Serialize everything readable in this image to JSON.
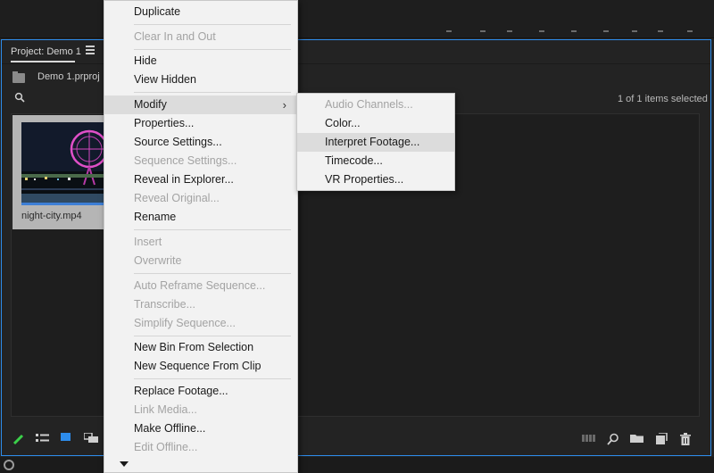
{
  "project_panel": {
    "tab_label": "Project: Demo 1",
    "project_file": "Demo 1.prproj",
    "selection_count": "1 of 1 items selected",
    "clip_name": "night-city.mp4"
  },
  "context_menu": {
    "items": [
      {
        "label": "Duplicate",
        "enabled": true
      },
      {
        "label": "Clear In and Out",
        "enabled": false
      },
      {
        "label": "Hide",
        "enabled": true
      },
      {
        "label": "View Hidden",
        "enabled": true
      },
      {
        "label": "Modify",
        "enabled": true,
        "has_submenu": true,
        "highlighted": true
      },
      {
        "label": "Properties...",
        "enabled": true
      },
      {
        "label": "Source Settings...",
        "enabled": true
      },
      {
        "label": "Sequence Settings...",
        "enabled": false
      },
      {
        "label": "Reveal in Explorer...",
        "enabled": true
      },
      {
        "label": "Reveal Original...",
        "enabled": false
      },
      {
        "label": "Rename",
        "enabled": true
      },
      {
        "label": "Insert",
        "enabled": false
      },
      {
        "label": "Overwrite",
        "enabled": false
      },
      {
        "label": "Auto Reframe Sequence...",
        "enabled": false
      },
      {
        "label": "Transcribe...",
        "enabled": false
      },
      {
        "label": "Simplify Sequence...",
        "enabled": false
      },
      {
        "label": "New Bin From Selection",
        "enabled": true
      },
      {
        "label": "New Sequence From Clip",
        "enabled": true
      },
      {
        "label": "Replace Footage...",
        "enabled": true
      },
      {
        "label": "Link Media...",
        "enabled": false
      },
      {
        "label": "Make Offline...",
        "enabled": true
      },
      {
        "label": "Edit Offline...",
        "enabled": false
      }
    ]
  },
  "submenu": {
    "items": [
      {
        "label": "Audio Channels...",
        "enabled": false
      },
      {
        "label": "Color...",
        "enabled": true
      },
      {
        "label": "Interpret Footage...",
        "enabled": true,
        "highlighted": true
      },
      {
        "label": "Timecode...",
        "enabled": true
      },
      {
        "label": "VR Properties...",
        "enabled": true
      }
    ]
  },
  "colors": {
    "panel_focus_border": "#2d8ceb",
    "menu_background": "#f2f2f2",
    "menu_highlight": "#dcdcdc",
    "disabled_text": "#a3a3a3"
  },
  "icons": {
    "panel_menu": "hamburger-icon",
    "search": "search-icon",
    "writable": "pencil-icon",
    "list_view": "list-view-icon",
    "icon_view": "icon-view-icon",
    "freeform_view": "freeform-view-icon",
    "automate": "automate-to-sequence-icon",
    "find": "find-icon",
    "new_bin": "new-bin-icon",
    "new_item": "new-item-icon",
    "trash": "trash-icon",
    "scroll_down": "triangle-down-icon"
  }
}
